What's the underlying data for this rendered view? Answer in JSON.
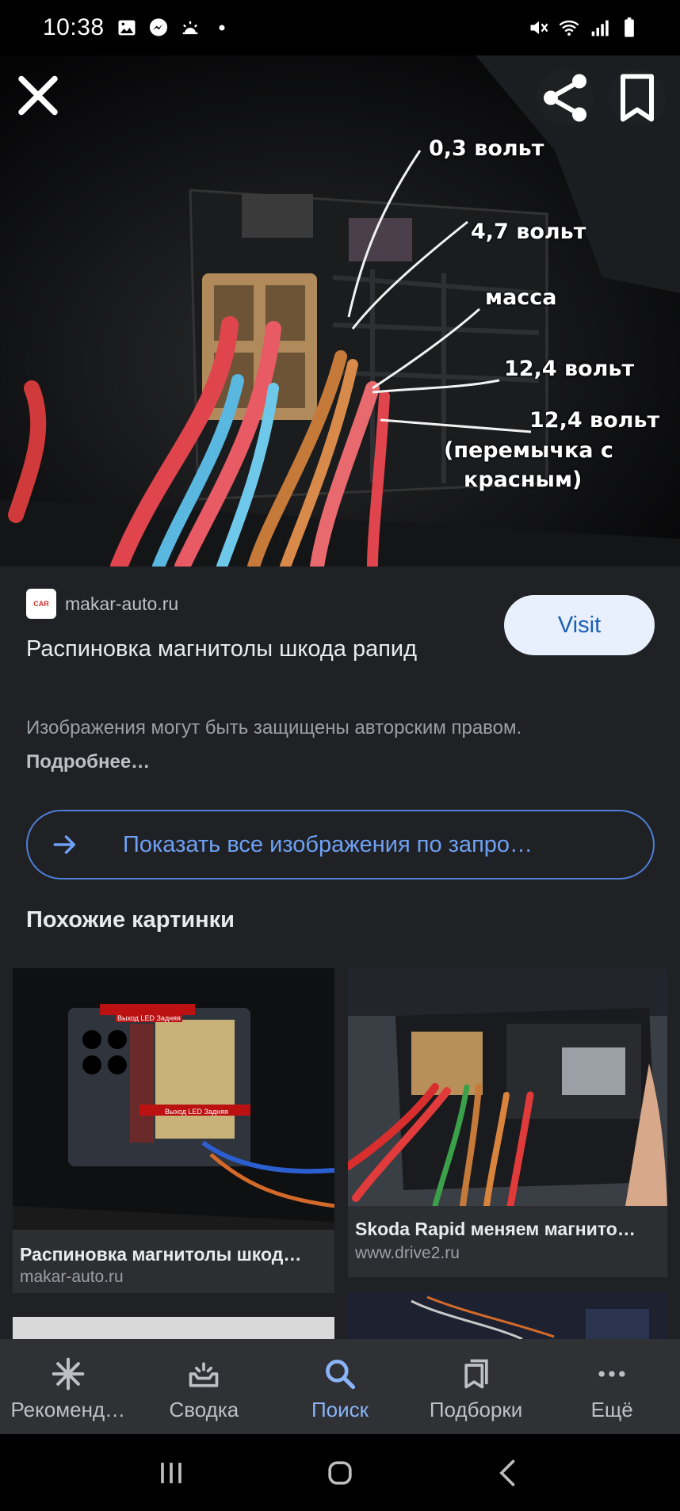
{
  "status_bar": {
    "time": "10:38",
    "left_icons": [
      "image-icon",
      "messenger-icon",
      "weather-icon",
      "dot-icon"
    ],
    "right_icons": [
      "mute-icon",
      "wifi-icon",
      "signal-icon",
      "battery-icon"
    ]
  },
  "hero": {
    "labels": [
      "0,3 вольт",
      "4,7 вольт",
      "масса",
      "12,4 вольт",
      "12,4 вольт",
      "(перемычка с",
      "красным)"
    ],
    "close_icon": "close-icon",
    "share_icon": "share-icon",
    "bookmark_icon": "bookmark-icon"
  },
  "result": {
    "favicon_text": "CAR",
    "source": "makar-auto.ru",
    "visit_label": "Visit",
    "title": "Распиновка магнитолы шкода рапид",
    "copyright_text": "Изображения могут быть защищены авторским правом.",
    "copyright_link": "Подробнее…",
    "show_all_label": "Показать все изображения по запро…"
  },
  "similar": {
    "heading": "Похожие картинки",
    "items": [
      {
        "title": "Распиновка магнитолы шкод…",
        "source": "makar-auto.ru",
        "tags": [
          "Выход LED Задняя",
          "Выход LED Задняя"
        ]
      },
      {
        "title": "Skoda Rapid меняем магнито…",
        "source": "www.drive2.ru"
      }
    ]
  },
  "bottom_nav": [
    {
      "label": "Рекоменд…",
      "icon": "sparkle-icon"
    },
    {
      "label": "Сводка",
      "icon": "inbox-icon"
    },
    {
      "label": "Поиск",
      "icon": "search-icon",
      "active": true
    },
    {
      "label": "Подборки",
      "icon": "collections-icon"
    },
    {
      "label": "Ещё",
      "icon": "more-icon"
    }
  ],
  "colors": {
    "background": "#202124",
    "accent": "#8ab4f8",
    "visit_bg": "#e8f0fe",
    "outline_blue": "#4e7fd9"
  }
}
